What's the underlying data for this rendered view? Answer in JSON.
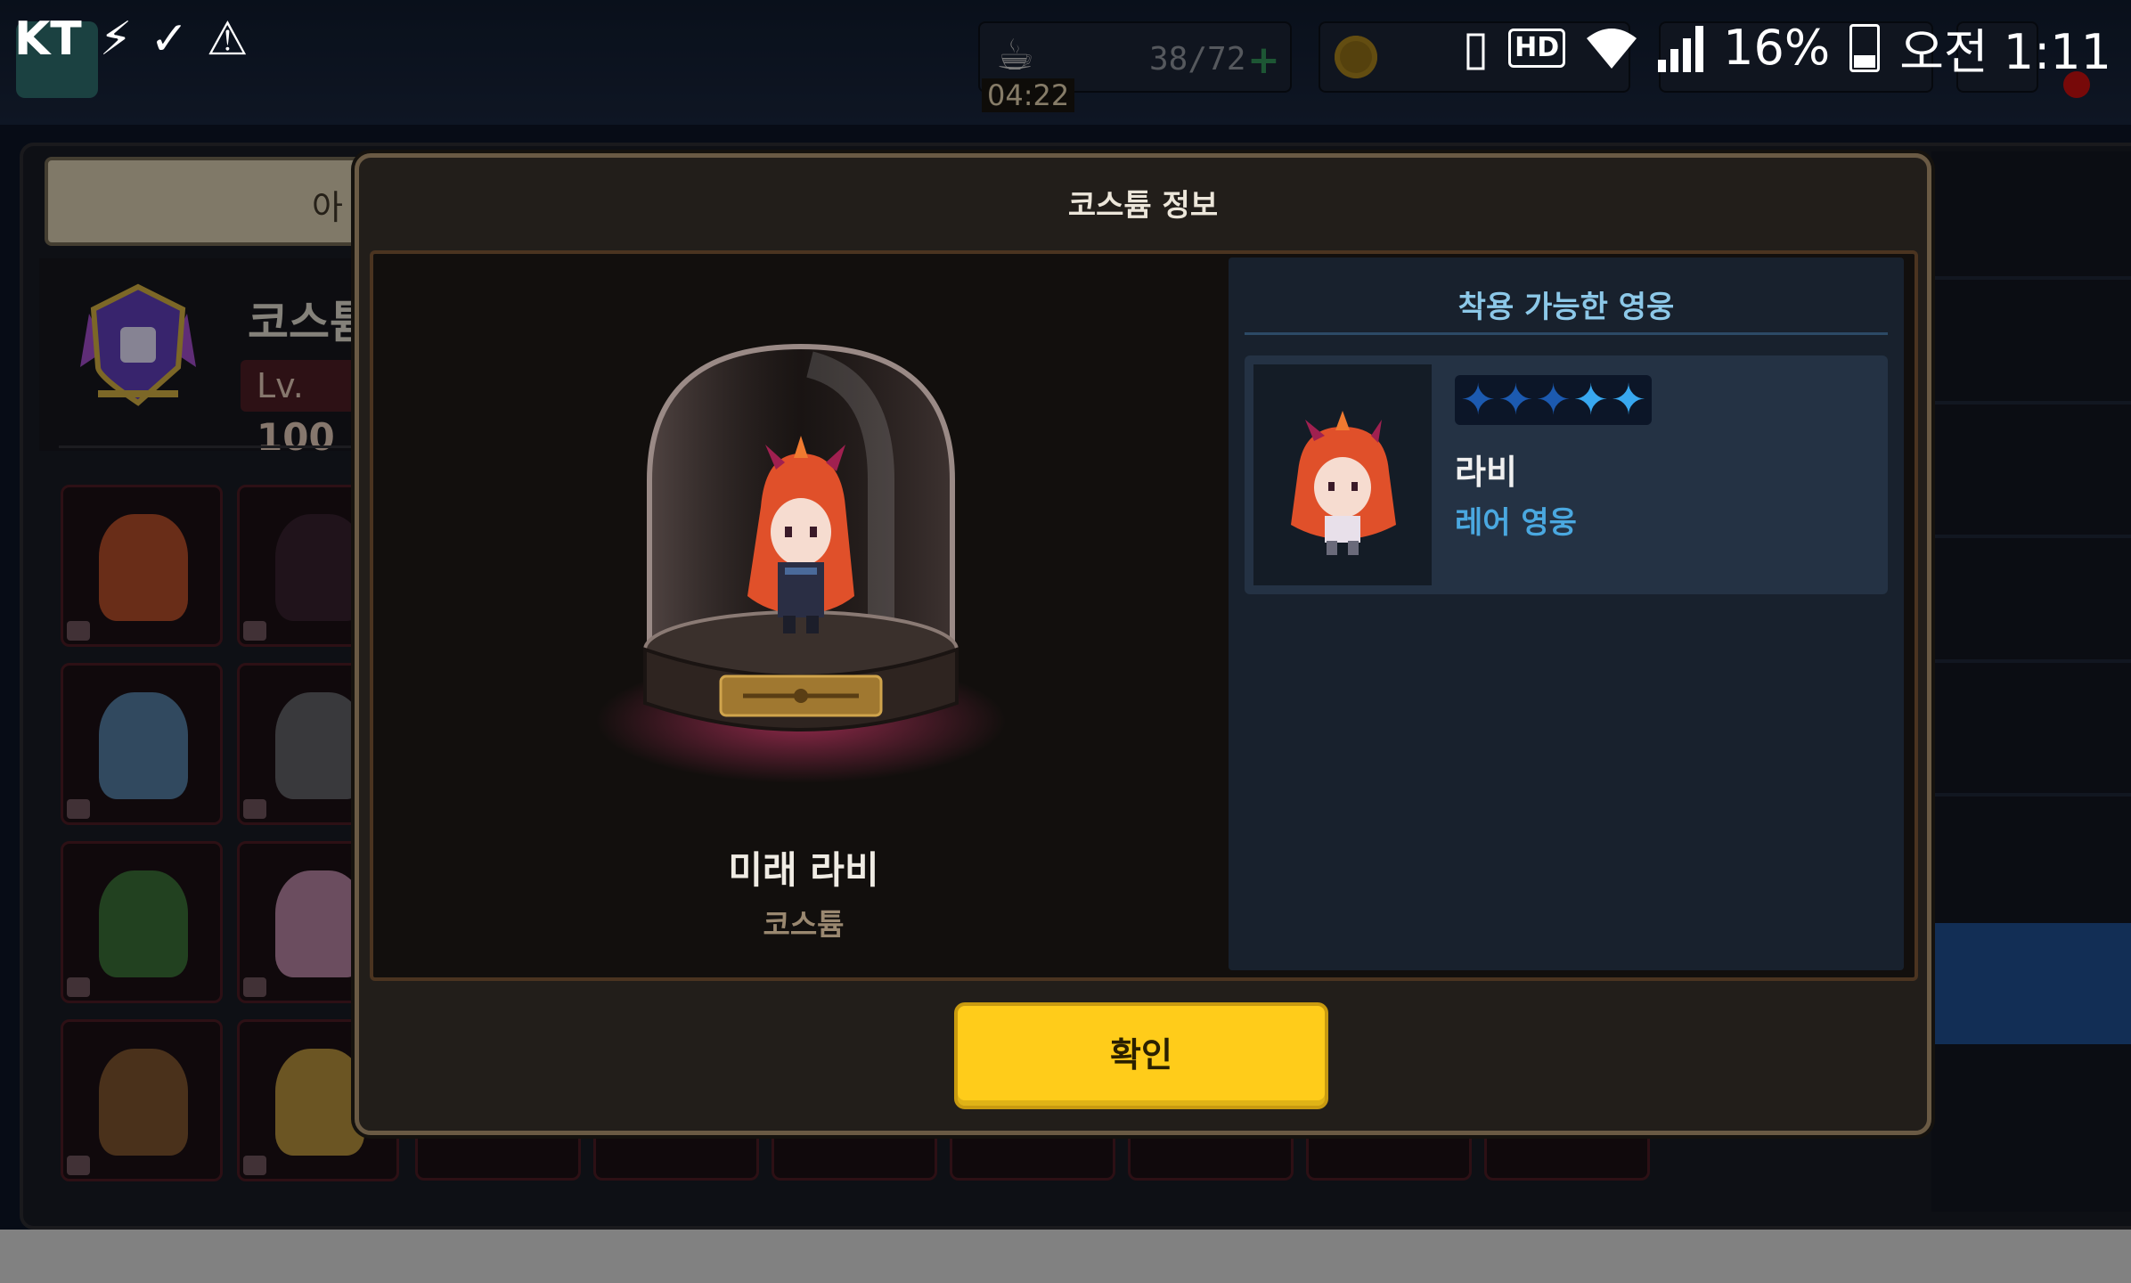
{
  "status_bar": {
    "carrier": "KT",
    "icons": [
      "usb-debug-icon",
      "download-complete-icon",
      "warning-icon"
    ],
    "right_icons": [
      "vibrate-icon",
      "hd-icon",
      "wifi-icon",
      "signal-icon",
      "battery-icon"
    ],
    "hd_label": "HD",
    "battery_percent": "16%",
    "time": "오전 1:11"
  },
  "background": {
    "stamina": "38/72",
    "stamina_timer": "04:22",
    "tab_label": "아",
    "collection_title": "코스튬",
    "level_prefix": "Lv.",
    "level_value": "100"
  },
  "modal": {
    "title": "코스튬 정보",
    "costume": {
      "name": "미래 라비",
      "type": "코스튬"
    },
    "hero_panel": {
      "title": "착용 가능한 영웅",
      "hero": {
        "name": "라비",
        "rarity": "레어 영웅",
        "stars": 5
      }
    },
    "confirm_label": "확인"
  },
  "colors": {
    "accent_button": "#ffcc1a",
    "rarity_text": "#4aa8e0",
    "panel_title": "#8cc8e8"
  }
}
